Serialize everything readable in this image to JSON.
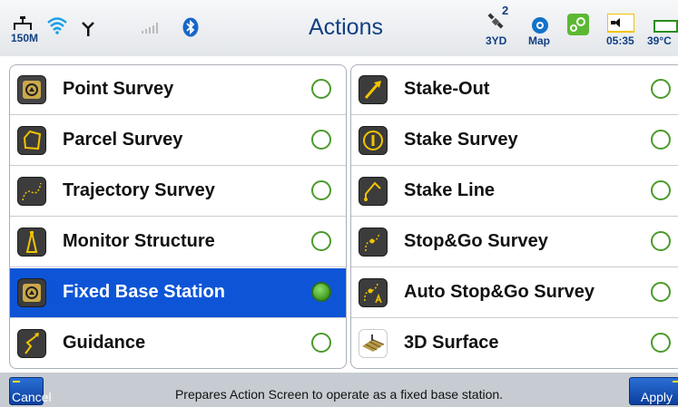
{
  "header": {
    "title": "Actions",
    "network_label": "150M",
    "gnss_sats": "2",
    "gnss_mode": "3YD",
    "map_label": "Map",
    "time": "05:35",
    "temperature": "39°C"
  },
  "icons": [
    "network-icon",
    "wifi-icon",
    "antenna-icon",
    "signal-bars-icon",
    "bluetooth-icon",
    "satellite-icon",
    "map-icon",
    "settings-icon",
    "speaker-icon",
    "battery-icon"
  ],
  "left_column": [
    {
      "label": "Point Survey",
      "icon": "point-survey-icon",
      "selected": false
    },
    {
      "label": "Parcel Survey",
      "icon": "parcel-survey-icon",
      "selected": false
    },
    {
      "label": "Trajectory Survey",
      "icon": "trajectory-survey-icon",
      "selected": false
    },
    {
      "label": "Monitor Structure",
      "icon": "monitor-structure-icon",
      "selected": false
    },
    {
      "label": "Fixed Base Station",
      "icon": "fixed-base-station-icon",
      "selected": true
    },
    {
      "label": "Guidance",
      "icon": "guidance-icon",
      "selected": false
    }
  ],
  "right_column": [
    {
      "label": "Stake-Out",
      "icon": "stake-out-icon",
      "selected": false
    },
    {
      "label": "Stake Survey",
      "icon": "stake-survey-icon",
      "selected": false
    },
    {
      "label": "Stake Line",
      "icon": "stake-line-icon",
      "selected": false
    },
    {
      "label": "Stop&Go Survey",
      "icon": "stop-go-survey-icon",
      "selected": false
    },
    {
      "label": "Auto Stop&Go Survey",
      "icon": "auto-stop-go-survey-icon",
      "selected": false
    },
    {
      "label": "3D Surface",
      "icon": "3d-surface-icon",
      "selected": false
    }
  ],
  "footer": {
    "cancel_label": "Cancel",
    "apply_label": "Apply",
    "hint": "Prepares Action Screen to operate as a fixed base station."
  },
  "colors": {
    "title": "#123f82",
    "selected_row": "#0d55d6",
    "radio": "#4b9a2b",
    "button": "#0b3f9c",
    "button_accent": "#ffe000"
  }
}
